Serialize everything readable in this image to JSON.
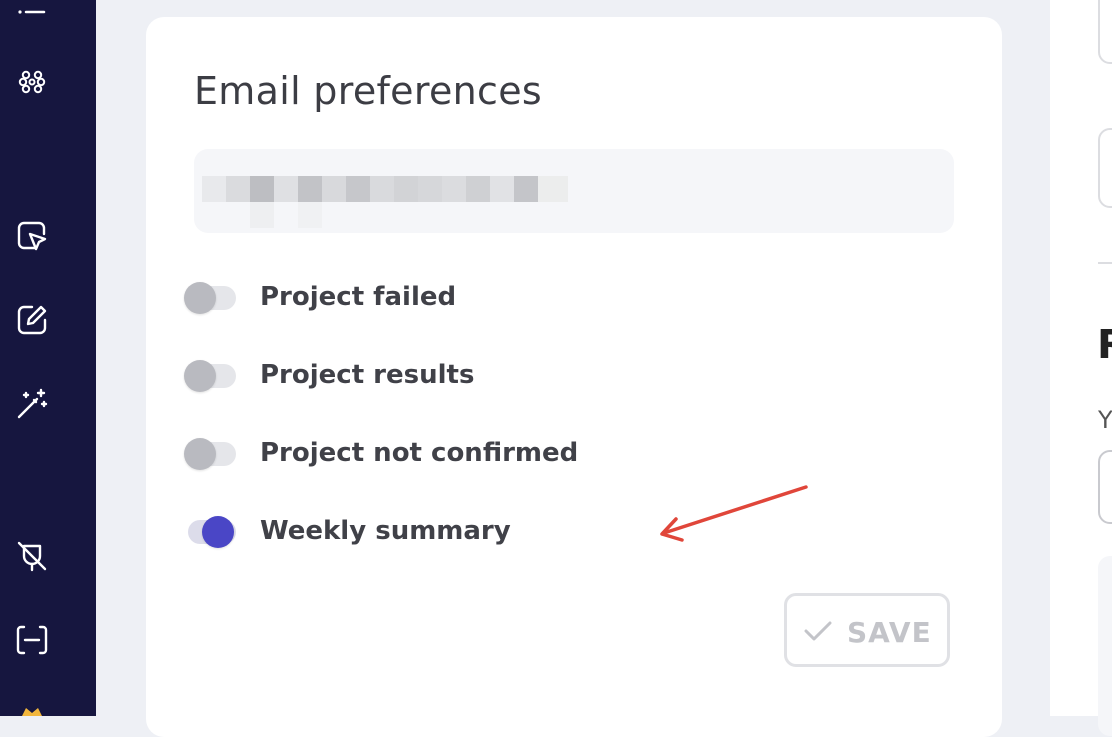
{
  "sidebar": {
    "icons": [
      "list-icon",
      "modules-icon",
      "cursor-icon",
      "edit-icon",
      "magic-wand-icon",
      "plug-off-icon",
      "minus-box-icon",
      "crown-icon"
    ]
  },
  "email_preferences": {
    "title": "Email preferences",
    "email_redacted": true,
    "toggles": [
      {
        "label": "Project failed",
        "on": false
      },
      {
        "label": "Project results",
        "on": false
      },
      {
        "label": "Project not confirmed",
        "on": false
      },
      {
        "label": "Weekly summary",
        "on": true
      }
    ],
    "save_label": "SAVE"
  },
  "right_panel": {
    "heading_fragment": "R",
    "label_fragment": "Y"
  },
  "colors": {
    "sidebar_bg": "#16163f",
    "accent": "#4a46c6",
    "annotation_arrow": "#e0463a"
  }
}
